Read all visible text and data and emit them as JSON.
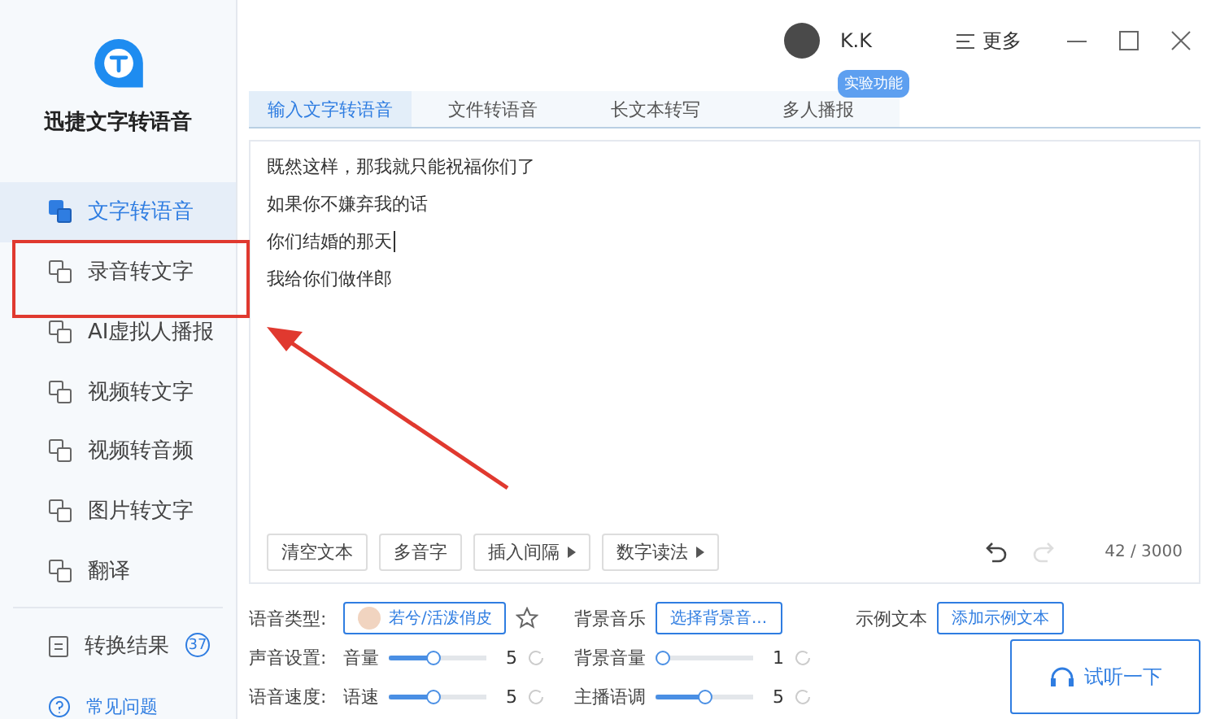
{
  "app": {
    "title": "迅捷文字转语音"
  },
  "sidebar": {
    "items": [
      {
        "label": "文字转语音",
        "selected": true
      },
      {
        "label": "录音转文字",
        "selected": false
      },
      {
        "label": "AI虚拟人播报",
        "selected": false
      },
      {
        "label": "视频转文字",
        "selected": false
      },
      {
        "label": "视频转音频",
        "selected": false
      },
      {
        "label": "图片转文字",
        "selected": false
      },
      {
        "label": "翻译",
        "selected": false
      }
    ],
    "results": {
      "label": "转换结果",
      "count": "37"
    },
    "help": "常见问题"
  },
  "header": {
    "user": "K.K",
    "more": "更多"
  },
  "tabs": [
    {
      "label": "输入文字转语音",
      "selected": true
    },
    {
      "label": "文件转语音",
      "selected": false
    },
    {
      "label": "长文本转写",
      "selected": false
    },
    {
      "label": "多人播报",
      "selected": false,
      "badge": "实验功能"
    }
  ],
  "editor": {
    "lines": [
      {
        "text": "既然这样，那我就只能祝福你们了",
        "caret": false
      },
      {
        "text": "如果你不嫌弃我的话",
        "caret": false
      },
      {
        "text": "你们结婚的那天",
        "caret": true
      },
      {
        "text": "我给你们做伴郎",
        "caret": false
      }
    ],
    "tools": [
      {
        "label": "清空文本",
        "kind": "plain"
      },
      {
        "label": "多音字",
        "kind": "plain"
      },
      {
        "label": "插入间隔",
        "kind": "menu"
      },
      {
        "label": "数字读法",
        "kind": "menu"
      }
    ],
    "history": [
      {
        "kind": "undo",
        "disabled": false
      },
      {
        "kind": "redo",
        "disabled": true
      }
    ],
    "count": "42 / 3000"
  },
  "settings": {
    "voice_type": {
      "label": "语音类型:",
      "value": "若兮/活泼俏皮"
    },
    "bg_music": {
      "label": "背景音乐",
      "value": "选择背景音..."
    },
    "sample_text": {
      "label": "示例文本",
      "value": "添加示例文本"
    },
    "rows": [
      {
        "label": "声音设置:",
        "sliders": [
          {
            "label": "音量",
            "level": 0.45,
            "reading": "5"
          },
          {
            "label": "背景音量",
            "level": 0,
            "reading": "1"
          }
        ]
      },
      {
        "label": "语音速度:",
        "sliders": [
          {
            "label": "语速",
            "level": 0.45,
            "reading": "5"
          },
          {
            "label": "主播语调",
            "level": 0.5,
            "reading": "5"
          }
        ]
      }
    ],
    "listen_button": "试听一下"
  }
}
